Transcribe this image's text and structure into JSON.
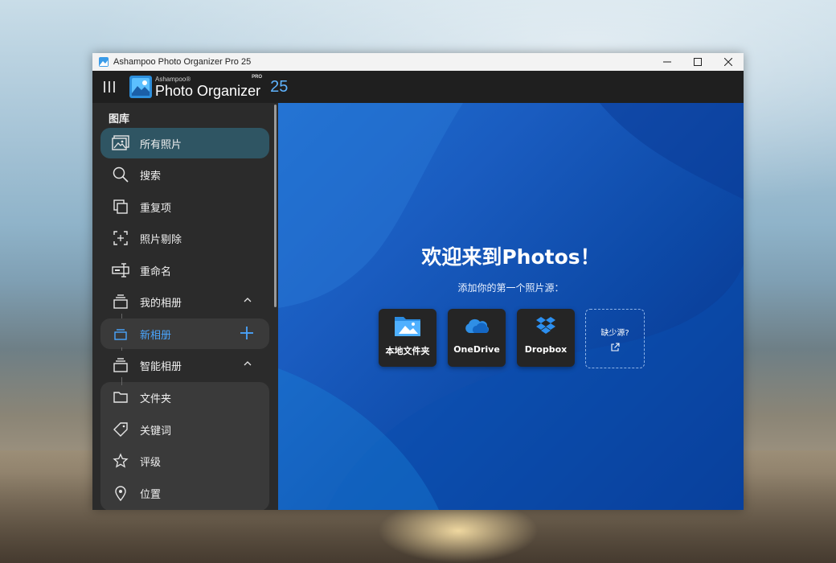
{
  "window": {
    "title": "Ashampoo Photo Organizer Pro 25"
  },
  "appbar": {
    "brand_small": "Ashampoo®",
    "brand_main": "Photo Organizer",
    "brand_pro": "PRO",
    "version": "25"
  },
  "sidebar": {
    "section_title": "图库",
    "items": [
      {
        "label": "所有照片",
        "icon": "photos-icon"
      },
      {
        "label": "搜索",
        "icon": "search-icon"
      },
      {
        "label": "重复项",
        "icon": "duplicates-icon"
      },
      {
        "label": "照片剔除",
        "icon": "cull-icon"
      },
      {
        "label": "重命名",
        "icon": "rename-icon"
      },
      {
        "label": "我的相册",
        "icon": "album-icon"
      },
      {
        "label": "新相册",
        "icon": "new-album-icon"
      },
      {
        "label": "智能相册",
        "icon": "smart-album-icon"
      },
      {
        "label": "文件夹",
        "icon": "folder-icon"
      },
      {
        "label": "关键词",
        "icon": "tag-icon"
      },
      {
        "label": "评级",
        "icon": "star-icon"
      },
      {
        "label": "位置",
        "icon": "location-icon"
      }
    ]
  },
  "main": {
    "title": "欢迎来到Photos！",
    "subtitle": "添加你的第一个照片源：",
    "sources": [
      {
        "label": "本地文件夹",
        "icon": "local-folder-icon"
      },
      {
        "label": "OneDrive",
        "icon": "onedrive-icon"
      },
      {
        "label": "Dropbox",
        "icon": "dropbox-icon"
      },
      {
        "label": "缺少源?",
        "icon": "external-link-icon"
      }
    ]
  },
  "colors": {
    "accent": "#4aa6ff",
    "active_item": "#2f5563",
    "sidebar_bg": "#2b2b2b",
    "appbar_bg": "#1f1f1f"
  }
}
